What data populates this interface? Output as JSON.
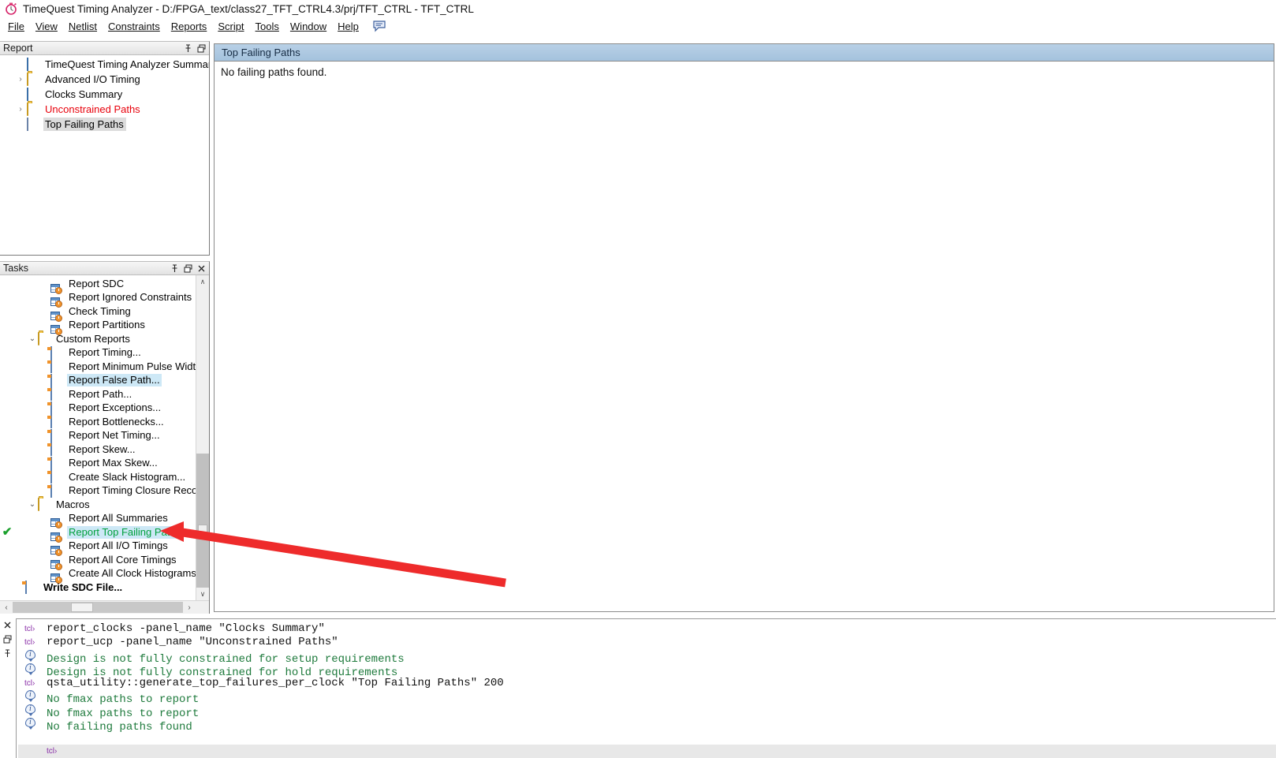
{
  "window": {
    "app_icon": "stopwatch-icon",
    "title": "TimeQuest Timing Analyzer - D:/FPGA_text/class27_TFT_CTRL4.3/prj/TFT_CTRL - TFT_CTRL"
  },
  "menubar": {
    "items": [
      {
        "label": "File",
        "mnemonic": "F"
      },
      {
        "label": "View",
        "mnemonic": "V"
      },
      {
        "label": "Netlist",
        "mnemonic": "N"
      },
      {
        "label": "Constraints",
        "mnemonic": "C"
      },
      {
        "label": "Reports",
        "mnemonic": "o"
      },
      {
        "label": "Script",
        "mnemonic": "S"
      },
      {
        "label": "Tools",
        "mnemonic": "T"
      },
      {
        "label": "Window",
        "mnemonic": "W"
      },
      {
        "label": "Help",
        "mnemonic": "H"
      }
    ],
    "comment_icon": "speech-bubble-icon"
  },
  "report_panel": {
    "title": "Report",
    "buttons": [
      {
        "name": "pin-icon",
        "glyph": "⇱"
      },
      {
        "name": "restore-icon",
        "glyph": "❐"
      }
    ],
    "tree": [
      {
        "label": "TimeQuest Timing Analyzer Summary",
        "icon": "grid-summary-icon",
        "expander": "",
        "depth": 1,
        "state": "normal"
      },
      {
        "label": "Advanced I/O Timing",
        "icon": "folder-icon",
        "expander": "›",
        "depth": 1,
        "state": "normal"
      },
      {
        "label": "Clocks Summary",
        "icon": "grid-summary-icon",
        "expander": "",
        "depth": 1,
        "state": "normal"
      },
      {
        "label": "Unconstrained Paths",
        "icon": "folder-icon",
        "expander": "›",
        "depth": 1,
        "state": "red"
      },
      {
        "label": "Top Failing Paths",
        "icon": "document-icon",
        "expander": "",
        "depth": 1,
        "state": "selected-grey"
      }
    ]
  },
  "tasks_panel": {
    "title": "Tasks",
    "buttons": [
      {
        "name": "pin-icon",
        "glyph": "⇱"
      },
      {
        "name": "restore-icon",
        "glyph": "❐"
      },
      {
        "name": "close-icon",
        "glyph": "✕"
      }
    ],
    "items": [
      {
        "label": "Report SDC",
        "icon": "task-icon",
        "depth": 2,
        "expander": "",
        "check": false,
        "state": "normal"
      },
      {
        "label": "Report Ignored Constraints",
        "icon": "task-icon",
        "depth": 2,
        "expander": "",
        "check": false,
        "state": "normal"
      },
      {
        "label": "Check Timing",
        "icon": "task-icon",
        "depth": 2,
        "expander": "",
        "check": false,
        "state": "normal"
      },
      {
        "label": "Report Partitions",
        "icon": "task-icon",
        "depth": 2,
        "expander": "",
        "check": false,
        "state": "normal"
      },
      {
        "label": "Custom Reports",
        "icon": "folder-open-icon",
        "depth": 1,
        "expander": "⌄",
        "check": false,
        "state": "normal"
      },
      {
        "label": "Report Timing...",
        "icon": "custom-report-icon",
        "depth": 2,
        "expander": "",
        "check": false,
        "state": "normal"
      },
      {
        "label": "Report Minimum Pulse Width...",
        "icon": "custom-report-icon",
        "depth": 2,
        "expander": "",
        "check": false,
        "state": "normal"
      },
      {
        "label": "Report False Path...",
        "icon": "custom-report-icon",
        "depth": 2,
        "expander": "",
        "check": false,
        "state": "hover-blue"
      },
      {
        "label": "Report Path...",
        "icon": "custom-report-icon",
        "depth": 2,
        "expander": "",
        "check": false,
        "state": "normal"
      },
      {
        "label": "Report Exceptions...",
        "icon": "custom-report-icon",
        "depth": 2,
        "expander": "",
        "check": false,
        "state": "normal"
      },
      {
        "label": "Report Bottlenecks...",
        "icon": "custom-report-icon",
        "depth": 2,
        "expander": "",
        "check": false,
        "state": "normal"
      },
      {
        "label": "Report Net Timing...",
        "icon": "custom-report-icon",
        "depth": 2,
        "expander": "",
        "check": false,
        "state": "normal"
      },
      {
        "label": "Report Skew...",
        "icon": "custom-report-icon",
        "depth": 2,
        "expander": "",
        "check": false,
        "state": "normal"
      },
      {
        "label": "Report Max Skew...",
        "icon": "custom-report-icon",
        "depth": 2,
        "expander": "",
        "check": false,
        "state": "normal"
      },
      {
        "label": "Create Slack Histogram...",
        "icon": "custom-report-icon",
        "depth": 2,
        "expander": "",
        "check": false,
        "state": "normal"
      },
      {
        "label": "Report Timing Closure Recomme",
        "icon": "custom-report-icon",
        "depth": 2,
        "expander": "",
        "check": false,
        "state": "normal"
      },
      {
        "label": "Macros",
        "icon": "folder-open-icon",
        "depth": 1,
        "expander": "⌄",
        "check": false,
        "state": "normal"
      },
      {
        "label": "Report All Summaries",
        "icon": "task-icon",
        "depth": 2,
        "expander": "",
        "check": false,
        "state": "normal"
      },
      {
        "label": "Report Top Failing Paths",
        "icon": "task-icon",
        "depth": 2,
        "expander": "",
        "check": true,
        "state": "selected-green"
      },
      {
        "label": "Report All I/O Timings",
        "icon": "task-icon",
        "depth": 2,
        "expander": "",
        "check": false,
        "state": "normal"
      },
      {
        "label": "Report All Core Timings",
        "icon": "task-icon",
        "depth": 2,
        "expander": "",
        "check": false,
        "state": "normal"
      },
      {
        "label": "Create All Clock Histograms",
        "icon": "task-icon",
        "depth": 2,
        "expander": "",
        "check": false,
        "state": "normal"
      },
      {
        "label": "Write SDC File...",
        "icon": "custom-report-icon",
        "depth": 0,
        "expander": "",
        "check": false,
        "state": "bold"
      }
    ],
    "vscroll": {
      "up_glyph": "∧",
      "down_glyph": "∨"
    },
    "hscroll": {
      "left_glyph": "‹",
      "right_glyph": "›"
    }
  },
  "main_view": {
    "title": "Top Failing Paths",
    "content": "No failing paths found."
  },
  "console": {
    "gutter_buttons": [
      {
        "name": "close-icon",
        "glyph": "✕"
      },
      {
        "name": "restore-icon",
        "glyph": "❐"
      },
      {
        "name": "pin-icon",
        "glyph": "⇱"
      }
    ],
    "lines": [
      {
        "kind": "tcl",
        "tag": "tcl›",
        "text": "report_clocks -panel_name \"Clocks Summary\"",
        "color": "black"
      },
      {
        "kind": "tcl",
        "tag": "tcl›",
        "text": "report_ucp -panel_name \"Unconstrained Paths\"",
        "color": "black"
      },
      {
        "kind": "info",
        "tag": "info-icon",
        "text": "Design is not fully constrained for setup requirements",
        "color": "green"
      },
      {
        "kind": "info",
        "tag": "info-icon",
        "text": "Design is not fully constrained for hold requirements",
        "color": "green"
      },
      {
        "kind": "tcl",
        "tag": "tcl›",
        "text": "qsta_utility::generate_top_failures_per_clock \"Top Failing Paths\" 200",
        "color": "black"
      },
      {
        "kind": "info",
        "tag": "info-icon",
        "text": "No fmax paths to report",
        "color": "green"
      },
      {
        "kind": "info",
        "tag": "info-icon",
        "text": "No fmax paths to report",
        "color": "green"
      },
      {
        "kind": "info",
        "tag": "info-icon",
        "text": "No failing paths found",
        "color": "green"
      }
    ],
    "prompt": "tcl›"
  },
  "annotation": {
    "arrow_color": "#ee2b2b",
    "name": "red-pointer-arrow"
  },
  "colors": {
    "accent_title": "#a4c2dd",
    "selection_blue": "#cde8f6",
    "selection_grey": "#dcdcdc",
    "error_red": "#e8000b",
    "success_green": "#00a03c",
    "console_green": "#1e7a3c",
    "tcl_purple": "#8a2fa8"
  }
}
